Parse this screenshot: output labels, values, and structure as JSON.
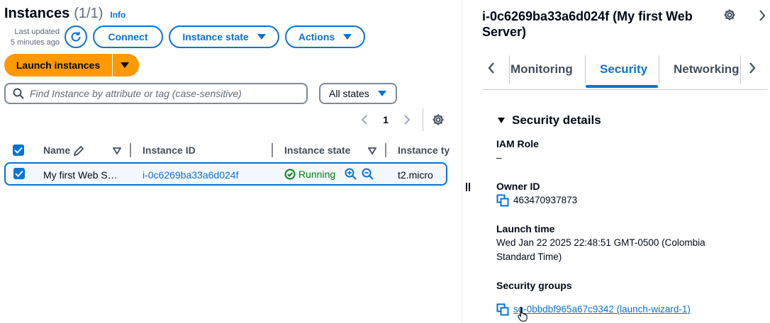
{
  "header": {
    "title": "Instances",
    "count": "(1/1)",
    "info_label": "Info",
    "last_updated": "Last updated",
    "last_updated_time": "5 minutes ago"
  },
  "actions": {
    "connect": "Connect",
    "instance_state": "Instance state",
    "actions": "Actions",
    "launch": "Launch instances"
  },
  "filter": {
    "search_placeholder": "Find Instance by attribute or tag (case-sensitive)",
    "state_select": "All states"
  },
  "pagination": {
    "current_page": "1"
  },
  "table": {
    "columns": [
      "Name",
      "Instance ID",
      "Instance state",
      "Instance ty"
    ],
    "rows": [
      {
        "name": "My first Web S…",
        "instance_id": "i-0c6269ba33a6d024f",
        "state": "Running",
        "type": "t2.micro"
      }
    ]
  },
  "detail": {
    "title": "i-0c6269ba33a6d024f (My first Web Server)",
    "tabs": [
      "Monitoring",
      "Security",
      "Networking"
    ],
    "active_tab": "Security",
    "section_title": "Security details",
    "fields": {
      "iam_role_label": "IAM Role",
      "iam_role_value": "–",
      "owner_id_label": "Owner ID",
      "owner_id_value": "463470937873",
      "launch_time_label": "Launch time",
      "launch_time_value": "Wed Jan 22 2025 22:48:51 GMT-0500 (Colombia Standard Time)",
      "security_groups_label": "Security groups",
      "security_group_value": "sg-0bbdbf965a67c9342 (launch-wizard-1)"
    }
  },
  "colors": {
    "primary": "#0972d3",
    "launch": "#ff9900",
    "running": "#037f0c",
    "text": "#000716",
    "muted": "#5f6b7a"
  }
}
